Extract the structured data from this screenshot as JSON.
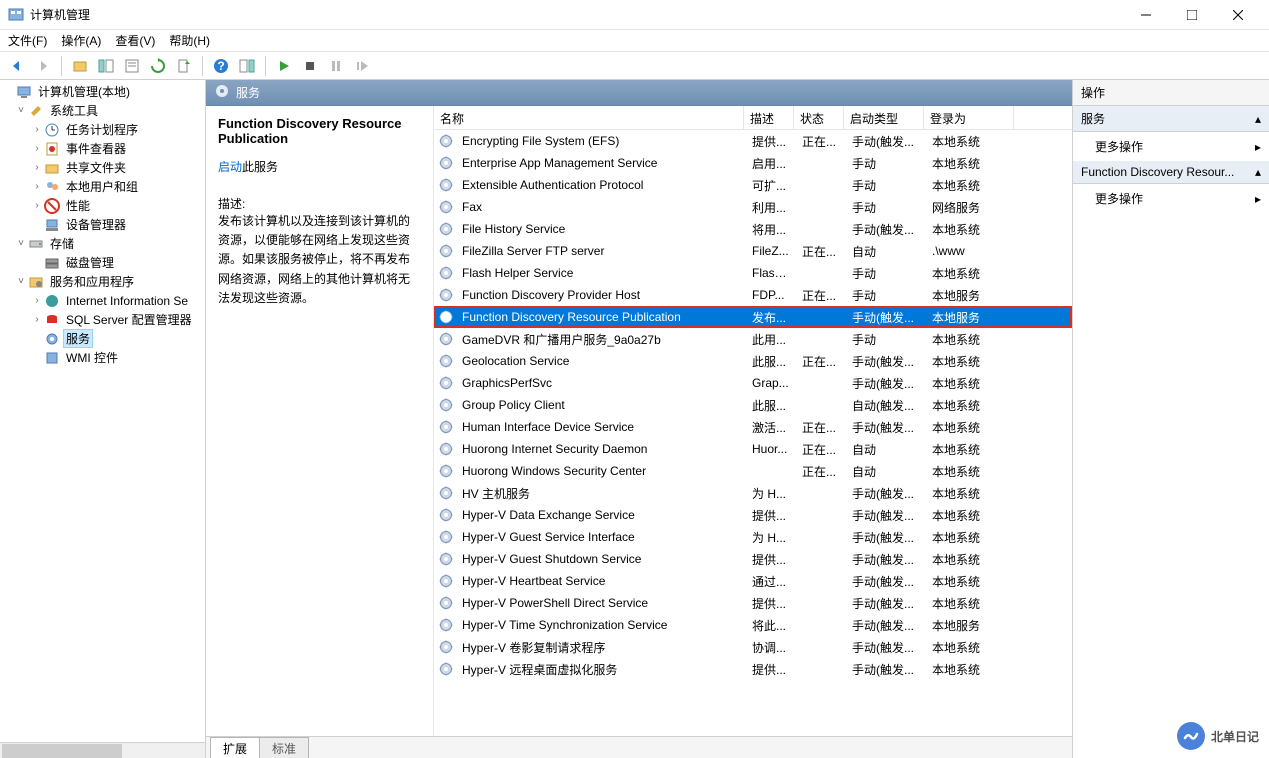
{
  "window": {
    "title": "计算机管理"
  },
  "menubar": [
    "文件(F)",
    "操作(A)",
    "查看(V)",
    "帮助(H)"
  ],
  "tree": {
    "root": "计算机管理(本地)",
    "system_tools": "系统工具",
    "task_scheduler": "任务计划程序",
    "event_viewer": "事件查看器",
    "shared_folders": "共享文件夹",
    "local_users": "本地用户和组",
    "performance": "性能",
    "device_mgr": "设备管理器",
    "storage": "存储",
    "disk_mgmt": "磁盘管理",
    "services_apps": "服务和应用程序",
    "iis": "Internet Information Se",
    "sql": "SQL Server 配置管理器",
    "services": "服务",
    "wmi": "WMI 控件"
  },
  "center": {
    "header": "服务",
    "selected_name": "Function Discovery Resource Publication",
    "start_link": "启动",
    "start_suffix": "此服务",
    "desc_label": "描述:",
    "desc": "发布该计算机以及连接到该计算机的资源，以便能够在网络上发现这些资源。如果该服务被停止，将不再发布网络资源，网络上的其他计算机将无法发现这些资源。"
  },
  "columns": {
    "name": "名称",
    "desc": "描述",
    "status": "状态",
    "startup": "启动类型",
    "logon": "登录为"
  },
  "services": [
    {
      "name": "Encrypting File System (EFS)",
      "desc": "提供...",
      "status": "正在...",
      "startup": "手动(触发...",
      "logon": "本地系统"
    },
    {
      "name": "Enterprise App Management Service",
      "desc": "启用...",
      "status": "",
      "startup": "手动",
      "logon": "本地系统"
    },
    {
      "name": "Extensible Authentication Protocol",
      "desc": "可扩...",
      "status": "",
      "startup": "手动",
      "logon": "本地系统"
    },
    {
      "name": "Fax",
      "desc": "利用...",
      "status": "",
      "startup": "手动",
      "logon": "网络服务"
    },
    {
      "name": "File History Service",
      "desc": "将用...",
      "status": "",
      "startup": "手动(触发...",
      "logon": "本地系统"
    },
    {
      "name": "FileZilla Server FTP server",
      "desc": "FileZ...",
      "status": "正在...",
      "startup": "自动",
      "logon": ".\\www"
    },
    {
      "name": "Flash Helper Service",
      "desc": "Flash...",
      "status": "",
      "startup": "手动",
      "logon": "本地系统"
    },
    {
      "name": "Function Discovery Provider Host",
      "desc": "FDP...",
      "status": "正在...",
      "startup": "手动",
      "logon": "本地服务"
    },
    {
      "name": "Function Discovery Resource Publication",
      "desc": "发布...",
      "status": "",
      "startup": "手动(触发...",
      "logon": "本地服务",
      "selected": true,
      "highlighted": true
    },
    {
      "name": "GameDVR 和广播用户服务_9a0a27b",
      "desc": "此用...",
      "status": "",
      "startup": "手动",
      "logon": "本地系统"
    },
    {
      "name": "Geolocation Service",
      "desc": "此服...",
      "status": "正在...",
      "startup": "手动(触发...",
      "logon": "本地系统"
    },
    {
      "name": "GraphicsPerfSvc",
      "desc": "Grap...",
      "status": "",
      "startup": "手动(触发...",
      "logon": "本地系统"
    },
    {
      "name": "Group Policy Client",
      "desc": "此服...",
      "status": "",
      "startup": "自动(触发...",
      "logon": "本地系统"
    },
    {
      "name": "Human Interface Device Service",
      "desc": "激活...",
      "status": "正在...",
      "startup": "手动(触发...",
      "logon": "本地系统"
    },
    {
      "name": "Huorong Internet Security Daemon",
      "desc": "Huor...",
      "status": "正在...",
      "startup": "自动",
      "logon": "本地系统"
    },
    {
      "name": "Huorong Windows Security Center",
      "desc": "",
      "status": "正在...",
      "startup": "自动",
      "logon": "本地系统"
    },
    {
      "name": "HV 主机服务",
      "desc": "为 H...",
      "status": "",
      "startup": "手动(触发...",
      "logon": "本地系统"
    },
    {
      "name": "Hyper-V Data Exchange Service",
      "desc": "提供...",
      "status": "",
      "startup": "手动(触发...",
      "logon": "本地系统"
    },
    {
      "name": "Hyper-V Guest Service Interface",
      "desc": "为 H...",
      "status": "",
      "startup": "手动(触发...",
      "logon": "本地系统"
    },
    {
      "name": "Hyper-V Guest Shutdown Service",
      "desc": "提供...",
      "status": "",
      "startup": "手动(触发...",
      "logon": "本地系统"
    },
    {
      "name": "Hyper-V Heartbeat Service",
      "desc": "通过...",
      "status": "",
      "startup": "手动(触发...",
      "logon": "本地系统"
    },
    {
      "name": "Hyper-V PowerShell Direct Service",
      "desc": "提供...",
      "status": "",
      "startup": "手动(触发...",
      "logon": "本地系统"
    },
    {
      "name": "Hyper-V Time Synchronization Service",
      "desc": "将此...",
      "status": "",
      "startup": "手动(触发...",
      "logon": "本地服务"
    },
    {
      "name": "Hyper-V 卷影复制请求程序",
      "desc": "协调...",
      "status": "",
      "startup": "手动(触发...",
      "logon": "本地系统"
    },
    {
      "name": "Hyper-V 远程桌面虚拟化服务",
      "desc": "提供...",
      "status": "",
      "startup": "手动(触发...",
      "logon": "本地系统"
    }
  ],
  "tabs": {
    "extended": "扩展",
    "standard": "标准"
  },
  "actions": {
    "header": "操作",
    "section1": "服务",
    "more1": "更多操作",
    "section2": "Function Discovery Resour...",
    "more2": "更多操作"
  },
  "watermark": "北单日记"
}
